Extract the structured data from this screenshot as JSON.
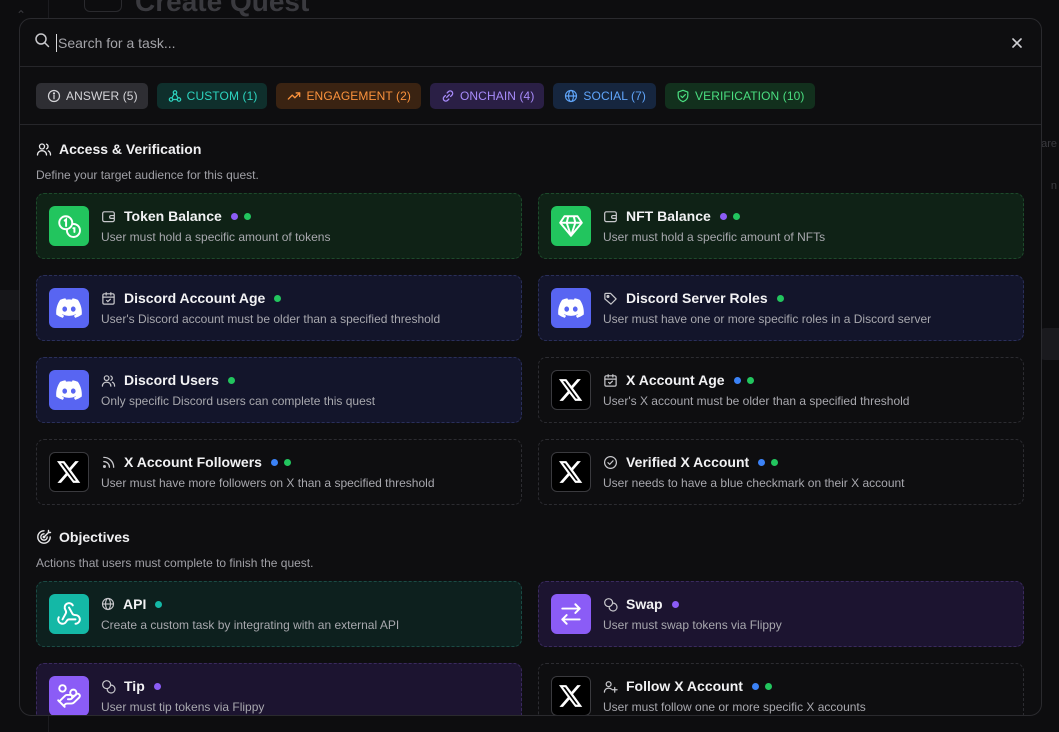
{
  "background": {
    "title": "Create Quest",
    "right_text_1": "are",
    "right_text_2": "n"
  },
  "search": {
    "placeholder": "Search for a task...",
    "value": ""
  },
  "filters": [
    {
      "label": "ANSWER (5)",
      "icon": "info-icon",
      "color": "#d4d4d8",
      "bg": "#2e2e33"
    },
    {
      "label": "CUSTOM (1)",
      "icon": "webhook-icon",
      "color": "#2dd4bf",
      "bg": "#0f2f2c"
    },
    {
      "label": "ENGAGEMENT (2)",
      "icon": "trending-up-icon",
      "color": "#fb923c",
      "bg": "#3a2312"
    },
    {
      "label": "ONCHAIN (4)",
      "icon": "link-icon",
      "color": "#a78bfa",
      "bg": "#2a1f45"
    },
    {
      "label": "SOCIAL (7)",
      "icon": "globe-icon",
      "color": "#60a5fa",
      "bg": "#16263f"
    },
    {
      "label": "VERIFICATION (10)",
      "icon": "shield-check-icon",
      "color": "#4ade80",
      "bg": "#12301d"
    }
  ],
  "sections": [
    {
      "title": "Access & Verification",
      "description": "Define your target audience for this quest.",
      "cards": [
        {
          "title": "Token Balance",
          "subtitle": "User must hold a specific amount of tokens",
          "icon": "coins-icon",
          "small_icon": "wallet-icon",
          "dots": [
            "purple",
            "green"
          ]
        },
        {
          "title": "NFT Balance",
          "subtitle": "User must hold a specific amount of NFTs",
          "icon": "gem-icon",
          "small_icon": "wallet-icon",
          "dots": [
            "purple",
            "green"
          ]
        },
        {
          "title": "Discord Account Age",
          "subtitle": "User's Discord account must be older than a specified threshold",
          "icon": "discord-icon",
          "small_icon": "calendar-icon",
          "dots": [
            "green"
          ]
        },
        {
          "title": "Discord Server Roles",
          "subtitle": "User must have one or more specific roles in a Discord server",
          "icon": "discord-icon",
          "small_icon": "tags-icon",
          "dots": [
            "green"
          ]
        },
        {
          "title": "Discord Users",
          "subtitle": "Only specific Discord users can complete this quest",
          "icon": "discord-icon",
          "small_icon": "users-icon",
          "dots": [
            "green"
          ]
        },
        {
          "title": "X Account Age",
          "subtitle": "User's X account must be older than a specified threshold",
          "icon": "x-logo-icon",
          "small_icon": "calendar-icon",
          "dots": [
            "blue",
            "green"
          ]
        },
        {
          "title": "X Account Followers",
          "subtitle": "User must have more followers on X than a specified threshold",
          "icon": "x-logo-icon",
          "small_icon": "rss-icon",
          "dots": [
            "blue",
            "green"
          ]
        },
        {
          "title": "Verified X Account",
          "subtitle": "User needs to have a blue checkmark on their X account",
          "icon": "x-logo-icon",
          "small_icon": "check-circle-icon",
          "dots": [
            "blue",
            "green"
          ]
        }
      ]
    },
    {
      "title": "Objectives",
      "description": "Actions that users must complete to finish the quest.",
      "cards": [
        {
          "title": "API",
          "subtitle": "Create a custom task by integrating with an external API",
          "icon": "webhook-icon",
          "small_icon": "globe-icon",
          "dots": [
            "teal"
          ]
        },
        {
          "title": "Swap",
          "subtitle": "User must swap tokens via Flippy",
          "icon": "swap-arrows-icon",
          "small_icon": "coins-icon",
          "dots": [
            "purple"
          ]
        },
        {
          "title": "Tip",
          "subtitle": "User must tip tokens via Flippy",
          "icon": "hand-coins-icon",
          "small_icon": "coins-icon",
          "dots": [
            "purple"
          ]
        },
        {
          "title": "Follow X Account",
          "subtitle": "User must follow one or more specific X accounts",
          "icon": "x-logo-icon",
          "small_icon": "user-plus-icon",
          "dots": [
            "blue",
            "green"
          ]
        }
      ]
    }
  ]
}
